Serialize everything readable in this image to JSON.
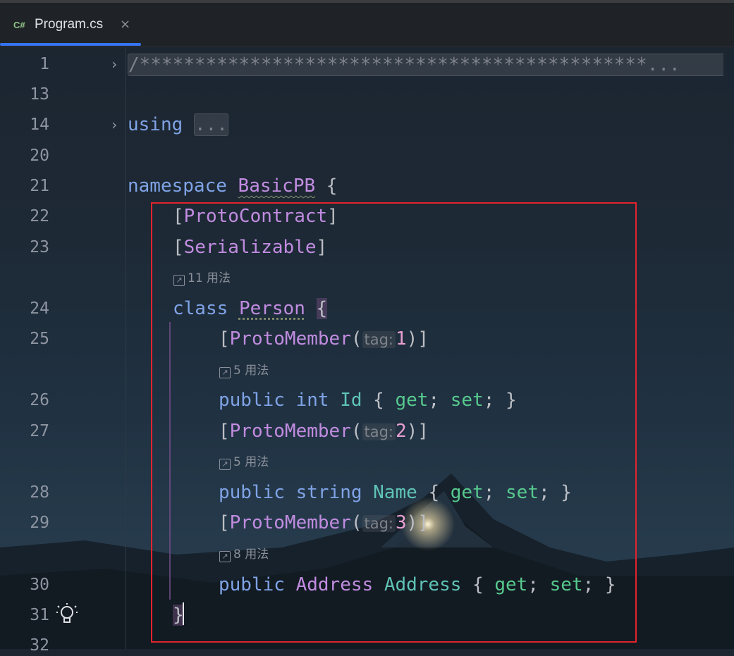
{
  "tab": {
    "lang_badge": "C#",
    "file_name": "Program.cs",
    "close_glyph": "×"
  },
  "line_numbers": {
    "l1": "1",
    "l13": "13",
    "l14": "14",
    "l20": "20",
    "l21": "21",
    "l22": "22",
    "l23": "23",
    "l24": "24",
    "l25": "25",
    "l26": "26",
    "l27": "27",
    "l28": "28",
    "l29": "29",
    "l30": "30",
    "l31": "31",
    "l32": "32"
  },
  "code": {
    "l1_comment": "/**********************************************",
    "l1_ellipsis": "...",
    "l14_using": "using",
    "l14_folded": "...",
    "l21_namespace": "namespace",
    "l21_name": "BasicPB",
    "l22_attr": "ProtoContract",
    "l23_attr": "Serializable",
    "l24_class": "class",
    "l24_name": "Person",
    "member_attr": "ProtoMember",
    "param_hint": "tag:",
    "tag1": "1",
    "tag2": "2",
    "tag3": "3",
    "public": "public",
    "int": "int",
    "string": "string",
    "address_type": "Address",
    "id": "Id",
    "name": "Name",
    "address": "Address",
    "get": "get",
    "set": "set"
  },
  "usages": {
    "person": "11 用法",
    "id": "5 用法",
    "name": "5 用法",
    "address": "8 用法"
  },
  "colors": {
    "accent_tab": "#3574f0",
    "highlight_box": "#e1242d"
  }
}
